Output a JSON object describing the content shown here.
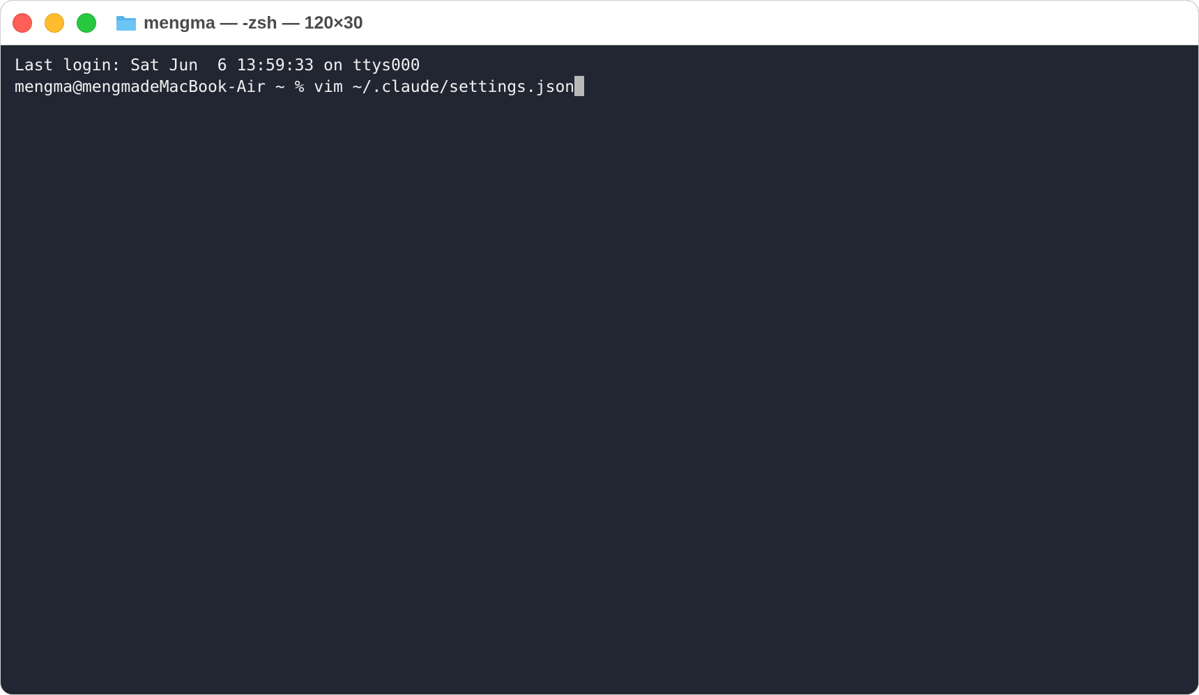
{
  "window": {
    "title": "mengma — -zsh — 120×30",
    "title_icon": "folder-icon",
    "buttons": {
      "close": "close-button",
      "minimize": "minimize-button",
      "zoom": "zoom-button"
    }
  },
  "terminal": {
    "last_login": "Last login: Sat Jun  6 13:59:33 on ttys000",
    "prompt": "mengma@mengmadeMacBook-Air ~ % ",
    "command": "vim ~/.claude/settings.json"
  },
  "colors": {
    "terminal_background": "#222633",
    "terminal_text": "#f1f1f1",
    "cursor": "#b9b9b9",
    "close": "#ff5f57",
    "minimize": "#febc2e",
    "zoom": "#28c840",
    "folder": "#54b3ed"
  }
}
